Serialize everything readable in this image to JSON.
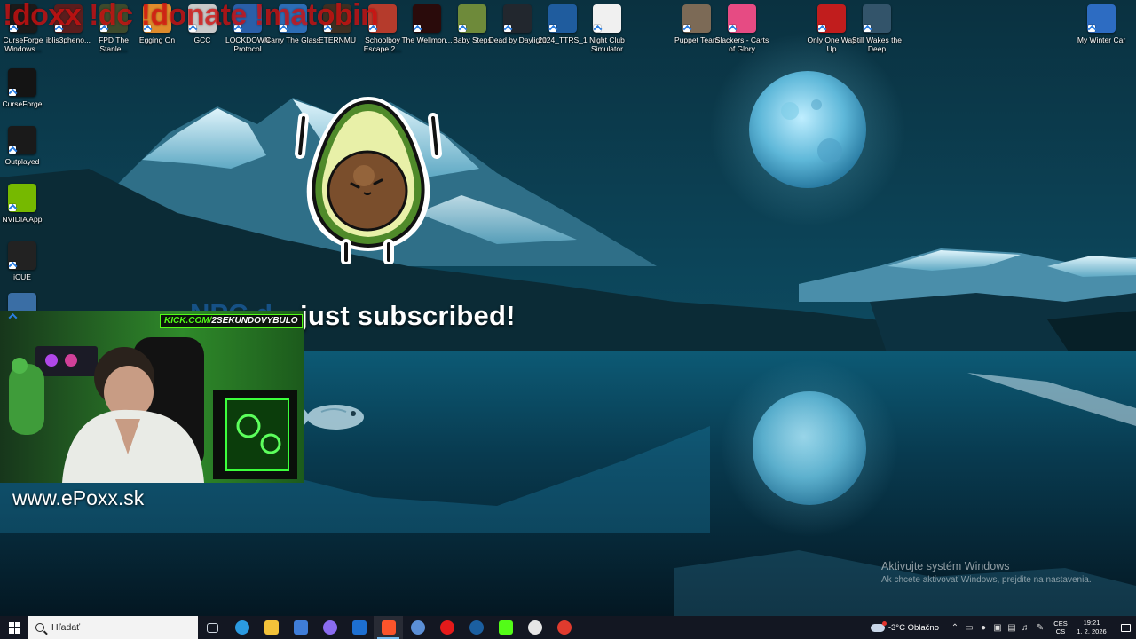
{
  "overlay": {
    "chat_commands": "!doxx !dc !donate !matobin",
    "sub_alert_name": "NPC d",
    "sub_alert_text": "just subscribed!",
    "kick_prefix": "KICK.COM/",
    "kick_channel": "2SEKUNDOVYBULO",
    "website": "www.ePoxx.sk"
  },
  "desktop_icons": [
    {
      "label": "CurseForge Windows...",
      "icon": "curseforge-windows-icon",
      "color": "#1a1a1a"
    },
    {
      "label": "iblis3pheno...",
      "icon": "iblis-game-icon",
      "color": "#5a1d1d"
    },
    {
      "label": "FPD The Stanle...",
      "icon": "fpd-stanley-icon",
      "color": "#3d4a2c"
    },
    {
      "label": "Egging On",
      "icon": "egging-on-icon",
      "color": "#e08b2b"
    },
    {
      "label": "GCC",
      "icon": "gcc-icon",
      "color": "#c9c9c9"
    },
    {
      "label": "LOCKDOWN Protocol",
      "icon": "lockdown-protocol-icon",
      "color": "#2a5fa8"
    },
    {
      "label": "Carry The Glass",
      "icon": "carry-the-glass-icon",
      "color": "#2c6db5"
    },
    {
      "label": "ETERNMU",
      "icon": "eternmu-icon",
      "color": "#3e2f22"
    },
    {
      "label": "Schoolboy Escape 2...",
      "icon": "schoolboy-escape-icon",
      "color": "#b53b2c"
    },
    {
      "label": "The Wellmon...",
      "icon": "wellmon-icon",
      "color": "#2a0b0b"
    },
    {
      "label": "Baby Steps",
      "icon": "baby-steps-icon",
      "color": "#6e8a3a"
    },
    {
      "label": "Dead by Daylight",
      "icon": "dead-by-daylight-icon",
      "color": "#22272e"
    },
    {
      "label": "2024_TTRS_1",
      "icon": "ttrs-icon",
      "color": "#1f5c9e"
    },
    {
      "label": "Night Club Simulator",
      "icon": "night-club-simulator-icon",
      "color": "#f0f0f0"
    },
    {
      "label": "Puppet Team",
      "icon": "puppet-team-icon",
      "color": "#7c6a56"
    },
    {
      "label": "Slackers - Carts of Glory",
      "icon": "slackers-icon",
      "color": "#e64b83"
    },
    {
      "label": "Only One Way Up",
      "icon": "only-one-way-up-icon",
      "color": "#c11d1d"
    },
    {
      "label": "Still Wakes the Deep",
      "icon": "still-wakes-the-deep-icon",
      "color": "#33546a"
    },
    {
      "label": "My Winter Car",
      "icon": "my-winter-car-icon",
      "color": "#2d6cc2"
    },
    {
      "label": "CurseForge",
      "icon": "curseforge-icon",
      "color": "#141414"
    },
    {
      "label": "Outplayed",
      "icon": "outplayed-icon",
      "color": "#1a1a1a"
    },
    {
      "label": "NVIDIA App",
      "icon": "nvidia-app-icon",
      "color": "#76b900"
    },
    {
      "label": "iCUE",
      "icon": "icue-icon",
      "color": "#222222"
    },
    {
      "label": "",
      "icon": "monitor-shortcut-icon",
      "color": "#3a6ea5"
    }
  ],
  "activation": {
    "title": "Aktivujte systém Windows",
    "subtitle": "Ak chcete aktivovať Windows, prejdite na nastavenia."
  },
  "taskbar": {
    "search_placeholder": "Hľadať",
    "apps": [
      {
        "icon": "task-view-icon",
        "color": "#cfd6df"
      },
      {
        "icon": "edge-icon",
        "color": "#2b9ae0"
      },
      {
        "icon": "file-explorer-icon",
        "color": "#f2c23a"
      },
      {
        "icon": "microsoft-store-icon",
        "color": "#3f7dd8"
      },
      {
        "icon": "copilot-icon",
        "color": "#8a6cf0"
      },
      {
        "icon": "outlook-icon",
        "color": "#1d6fd1"
      },
      {
        "icon": "brave-icon",
        "color": "#fb542b"
      },
      {
        "icon": "blue-app-icon",
        "color": "#5b8fd6"
      },
      {
        "icon": "opera-icon",
        "color": "#e41a1a"
      },
      {
        "icon": "steam-icon",
        "color": "#1b5fa0"
      },
      {
        "icon": "kick-icon",
        "color": "#53fc18"
      },
      {
        "icon": "obs-icon",
        "color": "#e6e6e6"
      },
      {
        "icon": "chrome-icon",
        "color": "#e03b2e"
      }
    ],
    "weather_text": "-3°C  Oblačno",
    "lang_top": "CES",
    "lang_bottom": "CS",
    "time": "19:21",
    "date": "1. 2. 2026"
  }
}
